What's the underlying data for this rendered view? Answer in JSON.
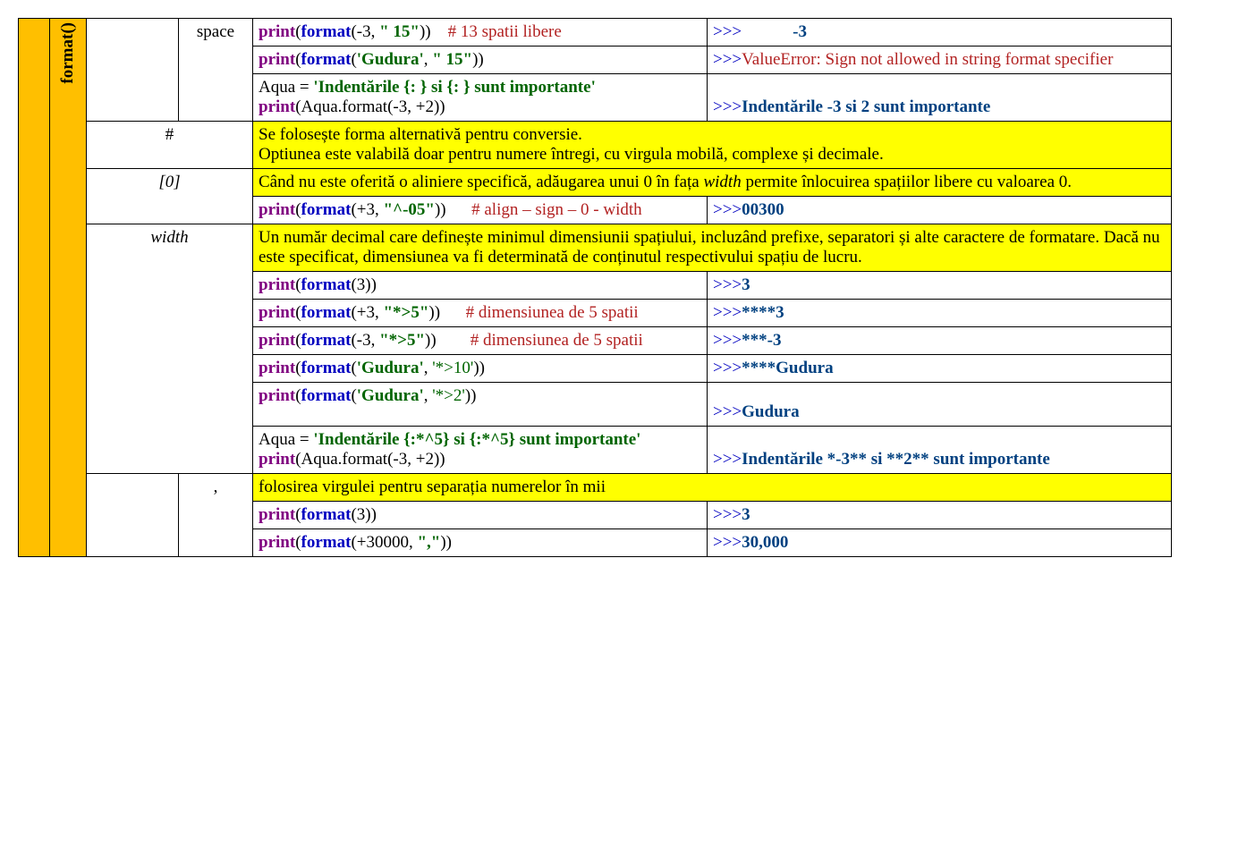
{
  "func": "format()",
  "space": {
    "label": "space",
    "r1": {
      "print": "print",
      "format": "format",
      "arg1": "-3",
      "arg2": "\" 15\"",
      "comment": "# 13 spatii libere",
      "prompt": ">>>",
      "out": "            -3"
    },
    "r2": {
      "print": "print",
      "format": "format",
      "arg1": "'Gudura'",
      "arg2": "\" 15\"",
      "prompt": ">>>",
      "err": "ValueError: Sign not allowed in string format specifier"
    },
    "r3": {
      "assignL": "Aqua = ",
      "assignR": "'Indentările {: } si {: } sunt importante'",
      "print": "print",
      "callobj": "Aqua.",
      "fn": "format",
      "args": "(-3, +2)",
      "prompt": ">>>",
      "out": "Indentările -3 si  2 sunt importante"
    }
  },
  "hash": {
    "label": "#",
    "desc1": "Se folosește forma alternativă pentru conversie.",
    "desc2": "Optiunea este valabilă doar pentru numere întregi, cu virgula mobilă, complexe și decimale."
  },
  "zero": {
    "label": "[0]",
    "desc_a": "Când nu este oferită o aliniere specifică, adăugarea unui 0 în fața ",
    "desc_w": "width",
    "desc_b": " permite înlocuirea spațiilor libere cu valoarea 0.",
    "r1": {
      "print": "print",
      "format": "format",
      "arg1": "+3",
      "arg2": "\"^-05\"",
      "comment": "# align – sign – 0 - width",
      "prompt": ">>>",
      "out": "00300"
    }
  },
  "width": {
    "label": "width",
    "desc": "Un număr decimal care definește minimul dimensiunii spațiului, incluzând prefixe, separatori și alte caractere de formatare. Dacă nu este specificat, dimensiunea va fi determinată de conținutul respectivului spațiu de lucru.",
    "r1": {
      "print": "print",
      "format": "format",
      "arg1": "3",
      "prompt": ">>>",
      "out": "3"
    },
    "r2": {
      "print": "print",
      "format": "format",
      "arg1": "+3",
      "arg2": "\"*>5\"",
      "comment": "# dimensiunea de 5 spatii",
      "prompt": ">>>",
      "out": "****3"
    },
    "r3": {
      "print": "print",
      "format": "format",
      "arg1": "-3",
      "arg2": "\"*>5\"",
      "comment": "# dimensiunea de 5 spatii",
      "prompt": ">>>",
      "out": "***-3"
    },
    "r4": {
      "print": "print",
      "format": "format",
      "arg1": "'Gudura'",
      "arg2": "'*>10'",
      "prompt": ">>>",
      "out": "****Gudura"
    },
    "r5": {
      "print": "print",
      "format": "format",
      "arg1": "'Gudura'",
      "arg2": "'*>2'",
      "prompt": ">>>",
      "out": "Gudura"
    },
    "r6": {
      "assignL": "Aqua = ",
      "assignR": "'Indentările {:*^5} si {:*^5} sunt importante'",
      "print": "print",
      "callobj": "Aqua.",
      "fn": "format",
      "args": "(-3, +2)",
      "prompt": ">>>",
      "out": "Indentările *-3** si **2** sunt importante"
    }
  },
  "comma": {
    "label": ",",
    "desc": "folosirea virgulei pentru separația numerelor în mii",
    "r1": {
      "print": "print",
      "format": "format",
      "arg1": "3",
      "prompt": ">>>",
      "out": "3"
    },
    "r2": {
      "print": "print",
      "format": "format",
      "arg1": "+30000",
      "arg2": "\",\"",
      "prompt": ">>>",
      "out": "30,000"
    }
  }
}
